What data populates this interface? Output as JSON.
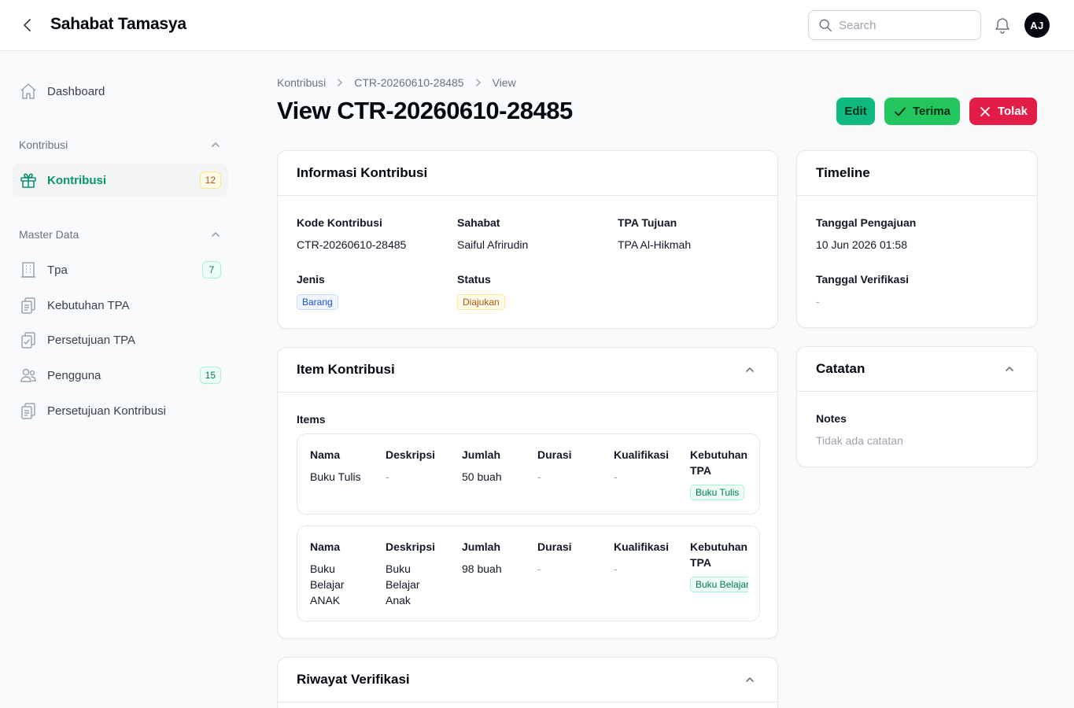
{
  "app": {
    "title": "Sahabat Tamasya",
    "user_initials": "AJ"
  },
  "search": {
    "placeholder": "Search"
  },
  "sidebar": {
    "dashboard": {
      "label": "Dashboard"
    },
    "groups": [
      {
        "label": "Kontribusi",
        "items": [
          {
            "label": "Kontribusi",
            "badge": "12",
            "active": true
          }
        ]
      },
      {
        "label": "Master Data",
        "items": [
          {
            "label": "Tpa",
            "badge": "7"
          },
          {
            "label": "Kebutuhan TPA"
          },
          {
            "label": "Persetujuan TPA"
          },
          {
            "label": "Pengguna",
            "badge": "15"
          },
          {
            "label": "Persetujuan Kontribusi"
          }
        ]
      }
    ]
  },
  "breadcrumb": [
    "Kontribusi",
    "CTR-20260610-28485",
    "View"
  ],
  "page_title": "View CTR-20260610-28485",
  "actions": {
    "edit": "Edit",
    "accept": "Terima",
    "reject": "Tolak"
  },
  "info": {
    "title": "Informasi Kontribusi",
    "fields": {
      "kode": {
        "label": "Kode Kontribusi",
        "value": "CTR-20260610-28485"
      },
      "sahabat": {
        "label": "Sahabat",
        "value": "Saiful Afrirudin"
      },
      "tpa": {
        "label": "TPA Tujuan",
        "value": "TPA Al-Hikmah"
      },
      "jenis": {
        "label": "Jenis",
        "value": "Barang"
      },
      "status": {
        "label": "Status",
        "value": "Diajukan"
      }
    }
  },
  "timeline": {
    "title": "Timeline",
    "pengajuan": {
      "label": "Tanggal Pengajuan",
      "value": "10 Jun 2026 01:58"
    },
    "verifikasi": {
      "label": "Tanggal Verifikasi",
      "value": "-"
    }
  },
  "items": {
    "title": "Item Kontribusi",
    "label": "Items",
    "headers": {
      "nama": "Nama",
      "deskripsi": "Deskripsi",
      "jumlah": "Jumlah",
      "durasi": "Durasi",
      "kualifikasi": "Kualifikasi",
      "kebutuhan_1": "Kebutuhan",
      "kebutuhan_2": "TPA"
    },
    "rows": [
      {
        "nama": [
          "Buku Tulis"
        ],
        "deskripsi": [
          "-"
        ],
        "jumlah": "50 buah",
        "durasi": "-",
        "kualifikasi": "-",
        "kebutuhan": "Buku Tulis"
      },
      {
        "nama": [
          "Buku",
          "Belajar",
          "ANAK"
        ],
        "deskripsi": [
          "Buku",
          "Belajar",
          "Anak"
        ],
        "jumlah": "98 buah",
        "durasi": "-",
        "kualifikasi": "-",
        "kebutuhan": "Buku Belajar"
      }
    ]
  },
  "catatan": {
    "title": "Catatan",
    "label": "Notes",
    "value": "Tidak ada catatan"
  },
  "riwayat": {
    "title": "Riwayat Verifikasi"
  }
}
